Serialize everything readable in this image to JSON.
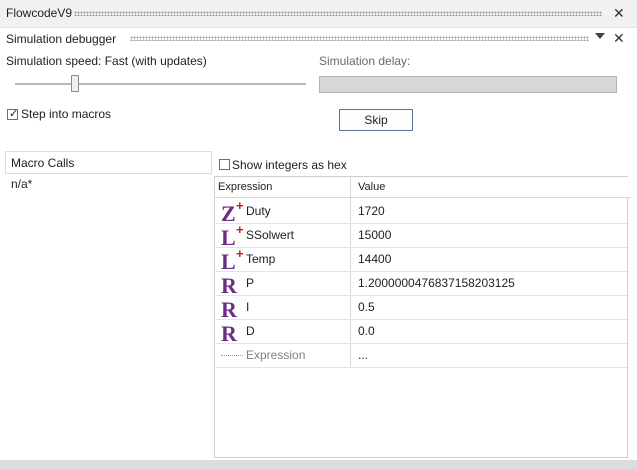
{
  "window": {
    "title": "FlowcodeV9"
  },
  "panel": {
    "title": "Simulation debugger"
  },
  "controls": {
    "speed_label": "Simulation speed: Fast (with updates)",
    "delay_label": "Simulation delay:",
    "step_into_label": "Step into macros",
    "step_into_checked": true,
    "skip_label": "Skip",
    "hex_label": "Show integers as hex",
    "hex_checked": false
  },
  "macro_calls": {
    "header": "Macro Calls",
    "items": [
      "n/a*"
    ]
  },
  "table": {
    "col_expression": "Expression",
    "col_value": "Value",
    "rows": [
      {
        "icon": "Z",
        "name": "Duty",
        "value": "1720",
        "plus": true
      },
      {
        "icon": "L",
        "name": "SSolwert",
        "value": "15000",
        "plus": true
      },
      {
        "icon": "L",
        "name": "Temp",
        "value": "14400",
        "plus": true
      },
      {
        "icon": "R",
        "name": "P",
        "value": "1.2000000476837158203125",
        "plus": false
      },
      {
        "icon": "R",
        "name": "I",
        "value": "0.5",
        "plus": false
      },
      {
        "icon": "R",
        "name": "D",
        "value": "0.0",
        "plus": false
      }
    ],
    "new_row": {
      "name": "Expression",
      "value": "..."
    }
  },
  "colors": {
    "accent": "#6b2e86",
    "plus": "#d01818",
    "text": "#1e1e1e"
  }
}
